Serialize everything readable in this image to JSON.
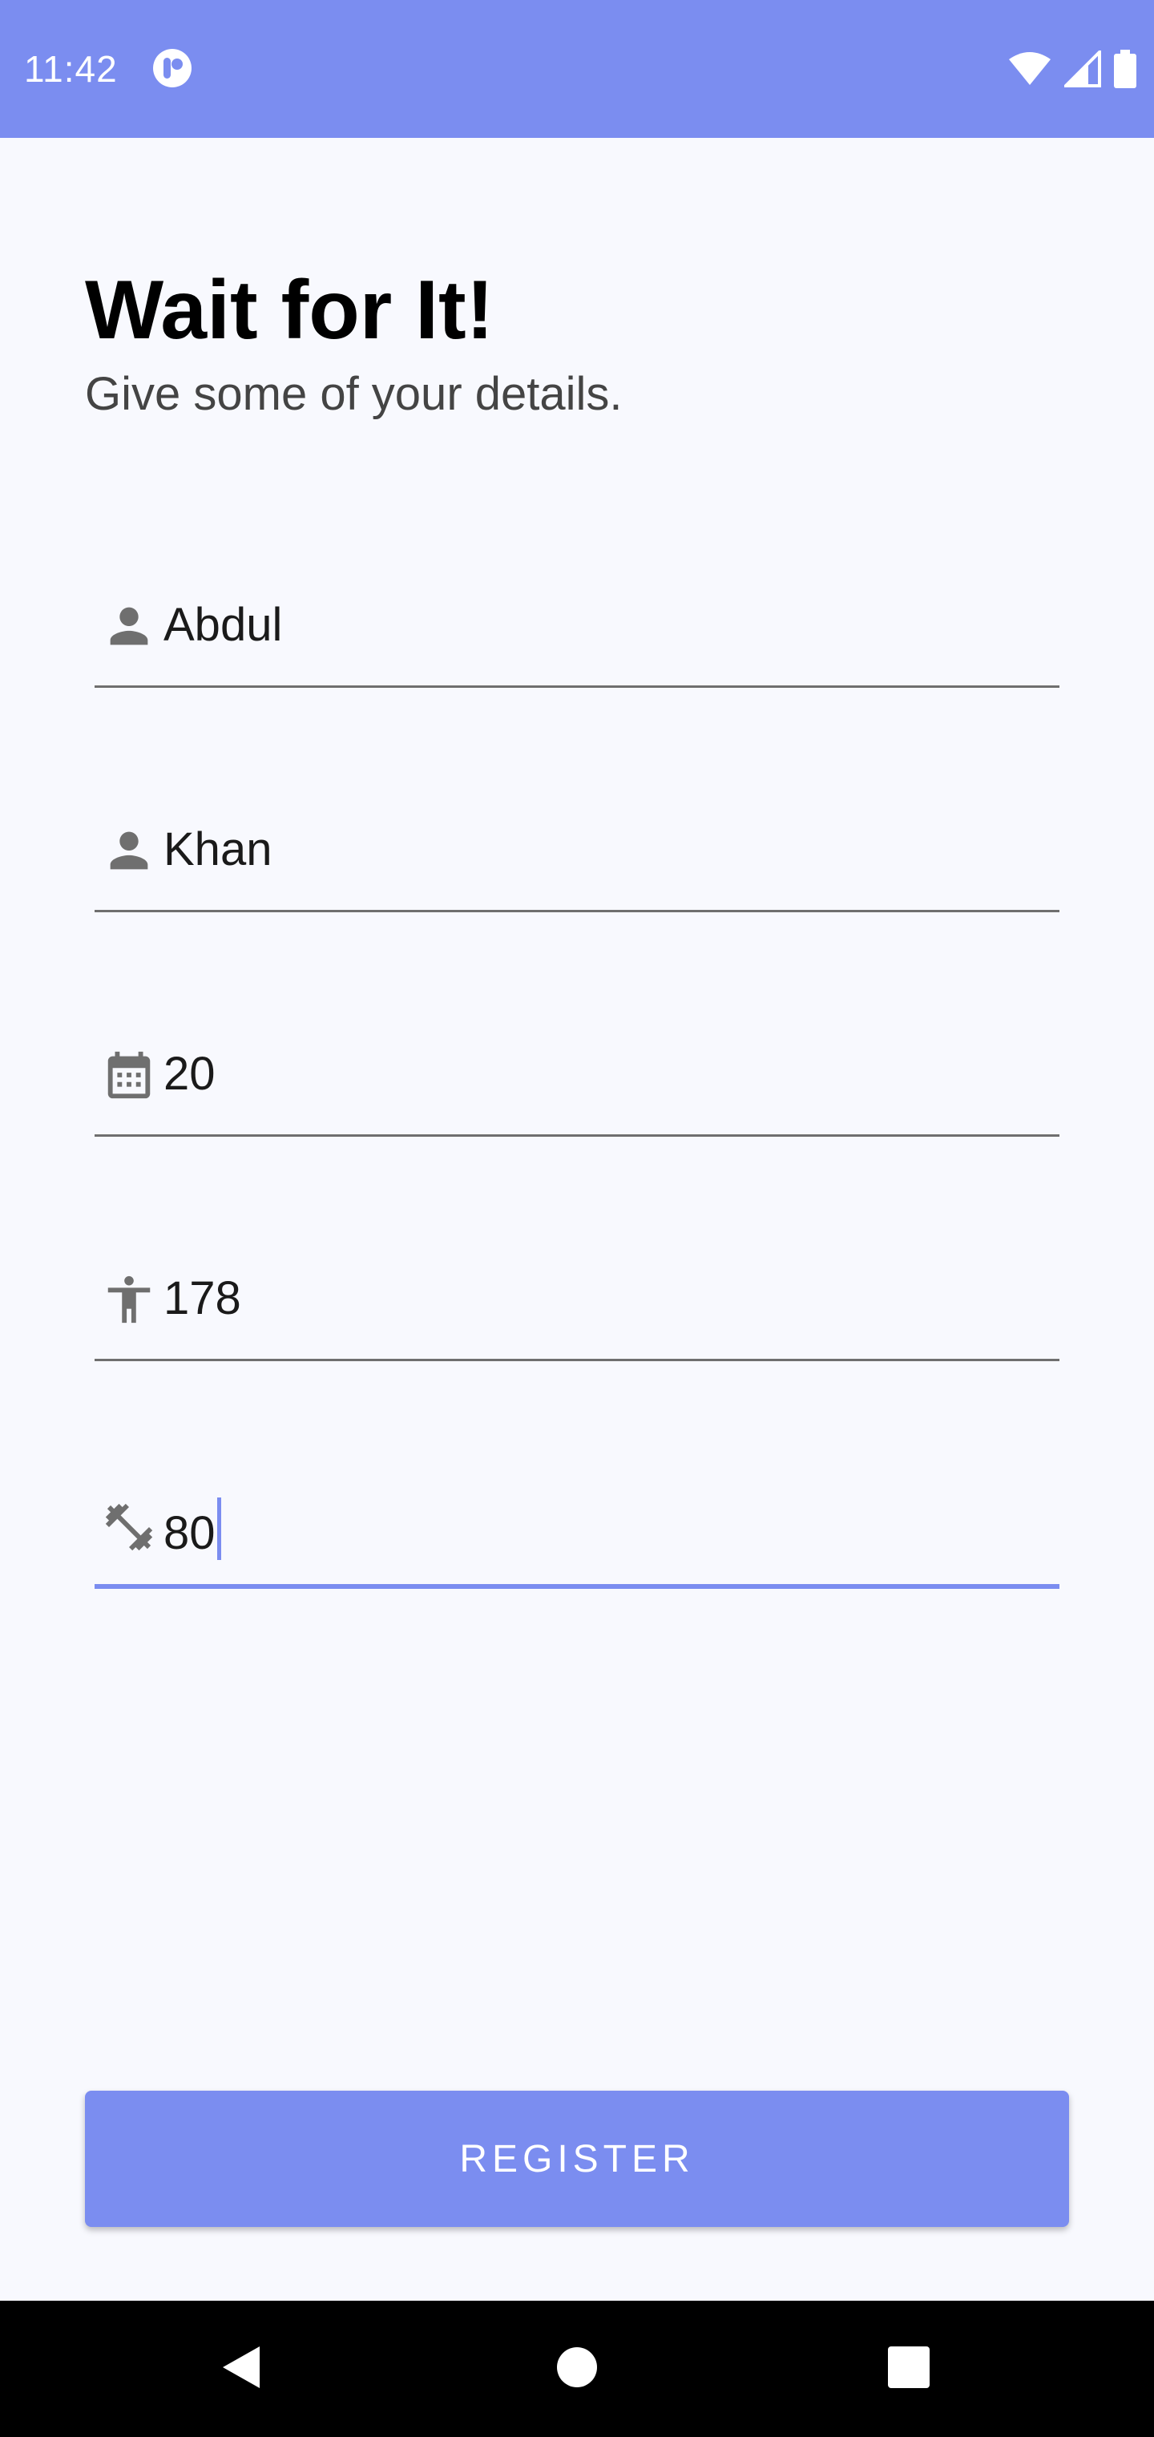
{
  "status_bar": {
    "time": "11:42",
    "icons": [
      "app-notification-icon",
      "wifi-icon",
      "cell-signal-icon",
      "battery-icon"
    ],
    "background": "#7B8DF0"
  },
  "header": {
    "title": "Wait for It!",
    "subtitle": "Give some of your details."
  },
  "form": {
    "fields": [
      {
        "name": "first-name",
        "icon": "person-icon",
        "value": "Abdul"
      },
      {
        "name": "last-name",
        "icon": "person-icon",
        "value": "Khan"
      },
      {
        "name": "age",
        "icon": "calendar-icon",
        "value": "20"
      },
      {
        "name": "height",
        "icon": "accessibility-icon",
        "value": "178"
      },
      {
        "name": "weight",
        "icon": "dumbbell-icon",
        "value": "80",
        "focused": true
      }
    ],
    "accent_color": "#7B8DF0"
  },
  "register_button": {
    "label": "REGISTER"
  },
  "nav_bar": {
    "icons": [
      "back-icon",
      "home-icon",
      "recents-icon"
    ]
  }
}
